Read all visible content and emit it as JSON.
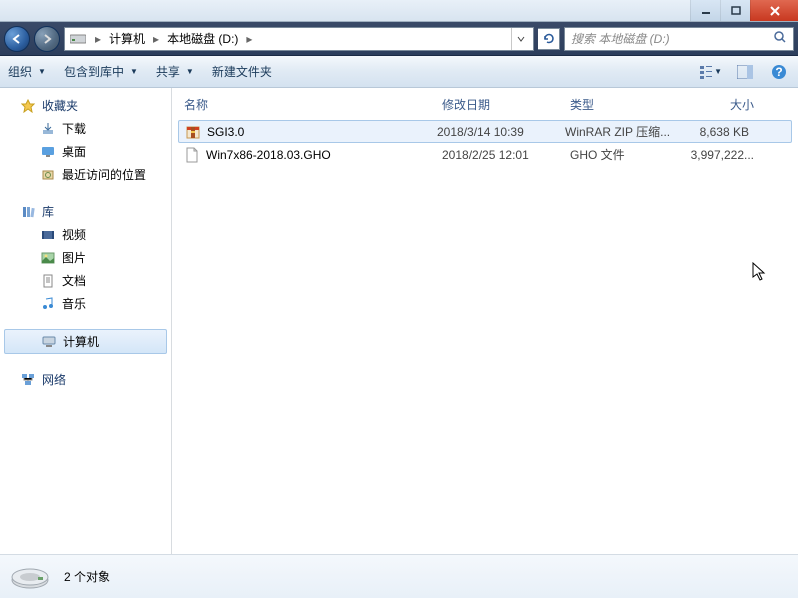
{
  "window": {
    "buttons": {
      "min": "minimize",
      "max": "maximize",
      "close": "close"
    }
  },
  "address": {
    "segments": [
      "计算机",
      "本地磁盘 (D:)"
    ],
    "search_placeholder": "搜索 本地磁盘 (D:)"
  },
  "toolbar": {
    "organize": "组织",
    "include": "包含到库中",
    "share": "共享",
    "newfolder": "新建文件夹"
  },
  "sidebar": {
    "favorites": {
      "label": "收藏夹",
      "items": [
        "下载",
        "桌面",
        "最近访问的位置"
      ]
    },
    "libraries": {
      "label": "库",
      "items": [
        "视频",
        "图片",
        "文档",
        "音乐"
      ]
    },
    "computer": {
      "label": "计算机"
    },
    "network": {
      "label": "网络"
    }
  },
  "columns": {
    "name": "名称",
    "date": "修改日期",
    "type": "类型",
    "size": "大小"
  },
  "files": [
    {
      "name": "SGI3.0",
      "date": "2018/3/14 10:39",
      "type": "WinRAR ZIP 压缩...",
      "size": "8,638 KB",
      "icon": "archive",
      "selected": true
    },
    {
      "name": "Win7x86-2018.03.GHO",
      "date": "2018/2/25 12:01",
      "type": "GHO 文件",
      "size": "3,997,222...",
      "icon": "file",
      "selected": false
    }
  ],
  "status": {
    "count_label": "2 个对象"
  }
}
